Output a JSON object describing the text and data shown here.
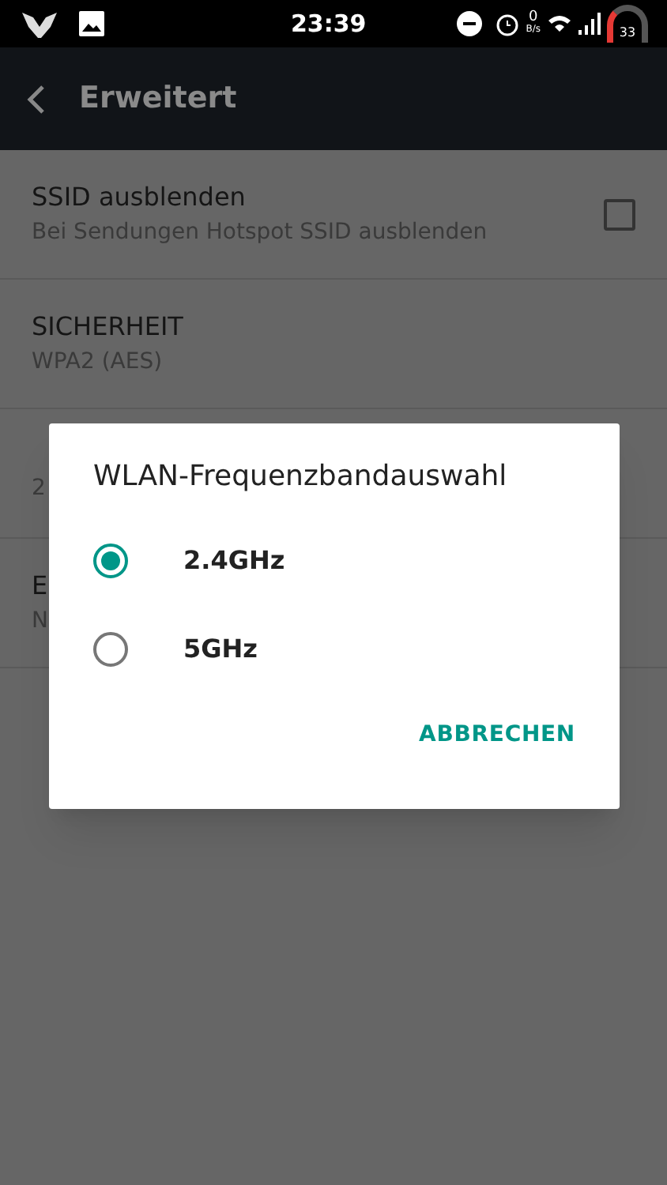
{
  "status_bar": {
    "time": "23:39",
    "net_speed": "0",
    "net_unit": "B/s",
    "battery": "33"
  },
  "app_bar": {
    "title": "Erweitert"
  },
  "settings": [
    {
      "kind": "checkbox",
      "title": "SSID ausblenden",
      "subtitle": "Bei Sendungen Hotspot SSID ausblenden",
      "checked": false
    },
    {
      "kind": "plain",
      "title": "SICHERHEIT",
      "subtitle": "WPA2 (AES)"
    },
    {
      "kind": "plain",
      "subtitle": "2"
    },
    {
      "kind": "plain",
      "title": "E",
      "subtitle": "N"
    }
  ],
  "dialog": {
    "title": "WLAN-Frequenzbandauswahl",
    "options": [
      {
        "label": "2.4GHz",
        "selected": true
      },
      {
        "label": "5GHz",
        "selected": false
      }
    ],
    "buttons": [
      "ABBRECHEN"
    ]
  }
}
